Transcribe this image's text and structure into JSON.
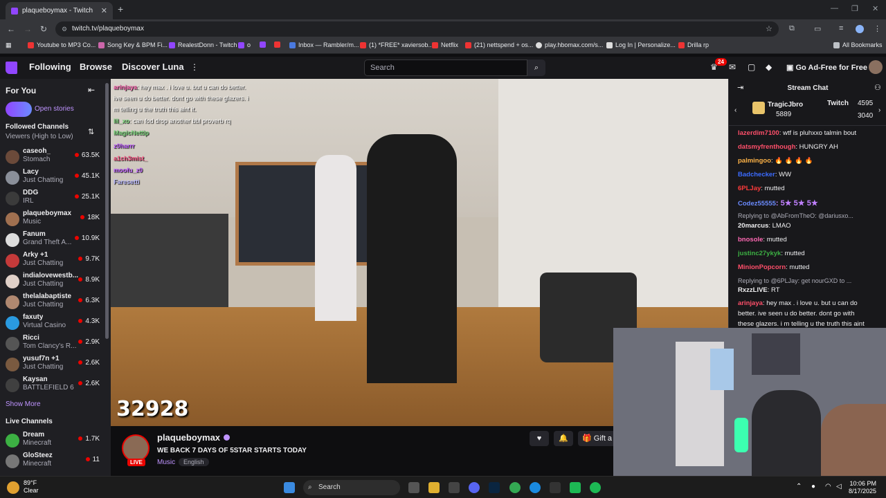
{
  "browser": {
    "tab_title": "plaqueboymax - Twitch",
    "url": "twitch.tv/plaqueboymax",
    "bookmarks": [
      "Youtube to MP3 Co...",
      "Song Key & BPM Fi...",
      "RealestDonn - Twitch",
      "o",
      "Inbox — Rambler/m...",
      "(1) *FREE* xaviersob...",
      "Netflix",
      "(21) nettspend + os...",
      "play.hbomax.com/s...",
      "Log In | Personalize...",
      "Drilla rp"
    ],
    "all_bookmarks": "All Bookmarks"
  },
  "topnav": {
    "following": "Following",
    "browse": "Browse",
    "discover": "Discover Luna",
    "search_placeholder": "Search",
    "notif_count": "24",
    "ad_free": "Go Ad-Free for Free"
  },
  "sidebar": {
    "for_you": "For You",
    "open_stories": "Open stories",
    "followed_channels": "Followed Channels",
    "sort": "Viewers (High to Low)",
    "channels": [
      {
        "name": "caseoh_",
        "game": "Stomach",
        "viewers": "63.5K",
        "color": "#6b4a3a"
      },
      {
        "name": "Lacy",
        "game": "Just Chatting",
        "viewers": "45.1K",
        "color": "#8a8f99"
      },
      {
        "name": "DDG",
        "game": "IRL",
        "viewers": "25.1K",
        "color": "#3b3b3b"
      },
      {
        "name": "plaqueboymax",
        "game": "Music",
        "viewers": "18K",
        "color": "#a07050"
      },
      {
        "name": "Fanum",
        "game": "Grand Theft A...",
        "viewers": "10.9K",
        "color": "#dddddd"
      },
      {
        "name": "Arky +1",
        "game": "Just Chatting",
        "viewers": "9.7K",
        "color": "#c43a3a"
      },
      {
        "name": "indialovewestb...",
        "game": "Just Chatting",
        "viewers": "8.9K",
        "color": "#e0d0c8"
      },
      {
        "name": "thelalabaptiste",
        "game": "Just Chatting",
        "viewers": "6.3K",
        "color": "#b08870"
      },
      {
        "name": "faxuty",
        "game": "Virtual Casino",
        "viewers": "4.3K",
        "color": "#2a9ae0"
      },
      {
        "name": "Ricci",
        "game": "Tom Clancy's R...",
        "viewers": "2.9K",
        "color": "#555555"
      },
      {
        "name": "yusuf7n +1",
        "game": "Just Chatting",
        "viewers": "2.6K",
        "color": "#7a5a40"
      },
      {
        "name": "Kaysan",
        "game": "BATTLEFIELD 6",
        "viewers": "2.6K",
        "color": "#404040"
      }
    ],
    "show_more": "Show More",
    "live_channels": "Live Channels",
    "live": [
      {
        "name": "Dream",
        "game": "Minecraft",
        "viewers": "1.7K",
        "color": "#3cb043"
      },
      {
        "name": "GloSteez",
        "game": "Minecraft",
        "viewers": "11",
        "color": "#777777"
      }
    ]
  },
  "video": {
    "overlay_chat": [
      {
        "user": "arinjaya",
        "text": ": hey max . i love u. but u can do better."
      },
      {
        "user": "",
        "text": "ive seen u do better. dont go with these glazers. i"
      },
      {
        "user": "",
        "text": "m telling u the truth this aint it."
      },
      {
        "user": "lil_xo",
        "text": ": can fod drop another bbl proverb rq"
      },
      {
        "user": "MagicNettip",
        "text": ""
      },
      {
        "user": "z0harrr",
        "text": ""
      },
      {
        "user": "a1ch3mist_",
        "text": ""
      },
      {
        "user": "moofu_z0",
        "text": ""
      },
      {
        "user": "Faresetti",
        "text": ""
      }
    ],
    "counter": "32928"
  },
  "info": {
    "channel": "plaqueboymax",
    "title": "WE BACK 7 DAYS OF 5STAR STARTS TODAY",
    "category": "Music",
    "tag": "English",
    "live": "LIVE",
    "gift": "Gift a"
  },
  "chat": {
    "title": "Stream Chat",
    "hype_user": "TragicJbro",
    "hype_user_count": "5889",
    "hype_twitch": "Twitch",
    "hype_twitch_a": "4595",
    "hype_twitch_b": "3040",
    "messages": [
      {
        "user": "lazerdim7100",
        "color": "#ff4f6a",
        "text": ": wtf is pluhxxo talmin bout"
      },
      {
        "user": "datsmyfrenthough",
        "color": "#ff4f6a",
        "text": ": HUNGRY AH"
      },
      {
        "user": "palmingoo",
        "color": "#ffb347",
        "text": ": 🔥 🔥 🔥 🔥"
      },
      {
        "user": "Badchecker",
        "color": "#3b6bff",
        "text": ": WW"
      },
      {
        "user": "6PLJay",
        "color": "#ff3b3b",
        "text": ": mutted"
      },
      {
        "user": "Codez55555",
        "color": "#6b8bff",
        "text": ": 5★ 5★ 5★"
      },
      {
        "user": "",
        "color": "#adadb8",
        "text": "Replying to @AbFromTheO: @dariusxo..."
      },
      {
        "user": "20marcus",
        "color": "#efeff1",
        "text": ": LMAO"
      },
      {
        "user": "bnosole",
        "color": "#ff69b4",
        "text": ": mutted"
      },
      {
        "user": "justinc27ykyk",
        "color": "#3cb043",
        "text": ": mutted"
      },
      {
        "user": "MinionPopcorn",
        "color": "#ff4f6a",
        "text": ": mutted"
      },
      {
        "user": "",
        "color": "#adadb8",
        "text": "Replying to @6PLJay: get nourGXD to ..."
      },
      {
        "user": "RxzzLIVE",
        "color": "#efeff1",
        "text": ": RT"
      },
      {
        "user": "arinjaya",
        "color": "#ff4f6a",
        "text": ": hey max . i love u. but u can do"
      },
      {
        "user": "",
        "color": "#efeff1",
        "text": "better. ive seen u do better. dont go with"
      },
      {
        "user": "",
        "color": "#efeff1",
        "text": "these glazers. i m telling u the truth this aint"
      }
    ]
  },
  "taskbar": {
    "temp": "89°F",
    "weather": "Clear",
    "search": "Search",
    "time": "10:06 PM",
    "date": "8/17/2025"
  },
  "colors": {
    "twitch_purple": "#9146ff",
    "live_red": "#eb0400",
    "bg_dark": "#0e0e10",
    "sidebar_bg": "#1f1f23"
  }
}
